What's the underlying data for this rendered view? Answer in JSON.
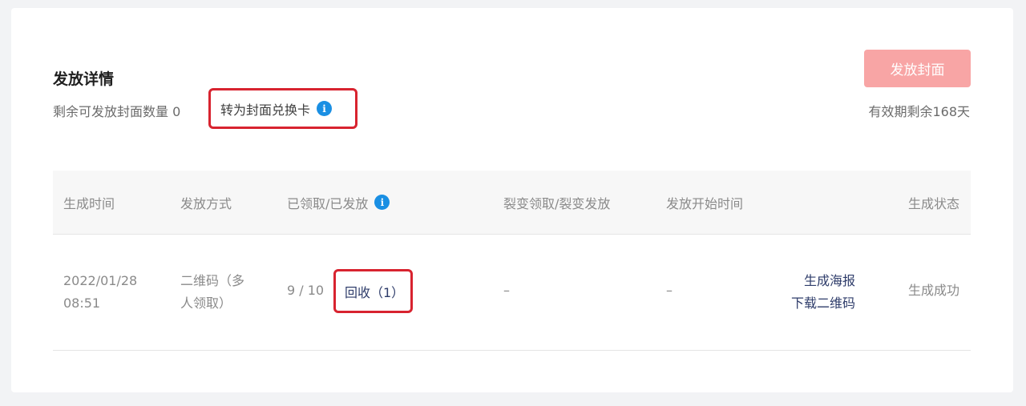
{
  "section": {
    "title": "发放详情",
    "remaining": "剩余可发放封面数量 0",
    "convert_label": "转为封面兑换卡",
    "issue_button": "发放封面",
    "validity": "有效期剩余168天"
  },
  "table": {
    "headers": [
      "生成时间",
      "发放方式",
      "已领取/已发放",
      "裂变领取/裂变发放",
      "发放开始时间",
      "生成状态"
    ],
    "rows": [
      {
        "date": "2022/01/28",
        "time": "08:51",
        "method_line1": "二维码（多",
        "method_line2": "人领取）",
        "claimed": "9 / 10",
        "recycle": "回收（1）",
        "fission": "–",
        "start_time": "–",
        "action_poster": "生成海报",
        "action_download": "下载二维码",
        "status": "生成成功"
      }
    ]
  },
  "colors": {
    "accent_link": "#2e3c6a",
    "highlight_border": "#d8232f",
    "issue_button_bg": "#f8a5a5",
    "info_icon": "#1a8fe3"
  },
  "icons": [
    "info-icon"
  ]
}
